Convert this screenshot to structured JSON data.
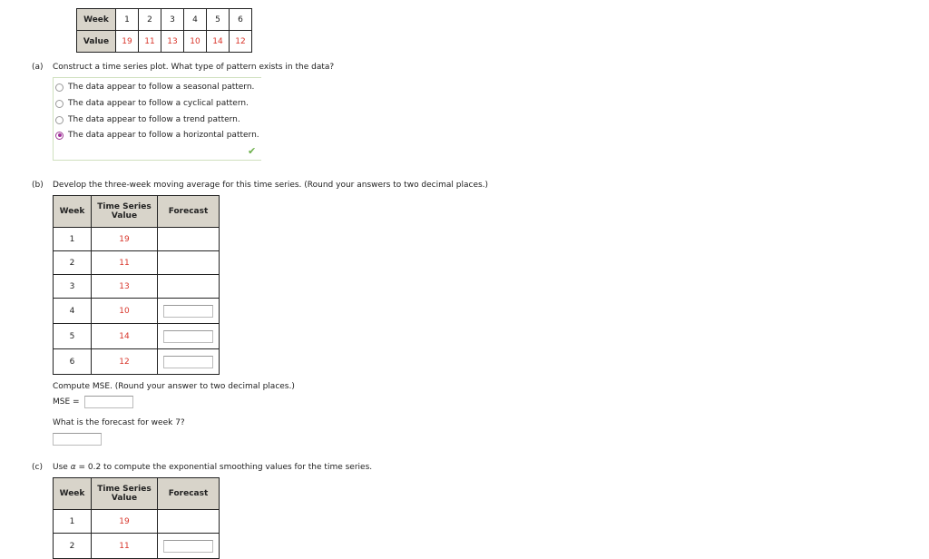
{
  "data_table": {
    "week_label": "Week",
    "value_label": "Value",
    "weeks": [
      "1",
      "2",
      "3",
      "4",
      "5",
      "6"
    ],
    "values": [
      "19",
      "11",
      "13",
      "10",
      "14",
      "12"
    ]
  },
  "part_a": {
    "label": "(a)",
    "question": "Construct a time series plot. What type of pattern exists in the data?",
    "options": [
      {
        "text": "The data appear to follow a seasonal pattern.",
        "selected": false
      },
      {
        "text": "The data appear to follow a cyclical pattern.",
        "selected": false
      },
      {
        "text": "The data appear to follow a trend pattern.",
        "selected": false
      },
      {
        "text": "The data appear to follow a horizontal pattern.",
        "selected": true
      }
    ],
    "status_icon": "checkmark-icon",
    "status_symbol": "✔"
  },
  "part_b": {
    "label": "(b)",
    "question": "Develop the three-week moving average for this time series. (Round your answers to two decimal places.)",
    "table": {
      "headers": [
        "Week",
        "Time Series Value",
        "Forecast"
      ],
      "header_value_line1": "Time Series",
      "header_value_line2": "Value",
      "rows": [
        {
          "week": "1",
          "value": "19",
          "forecast": null
        },
        {
          "week": "2",
          "value": "11",
          "forecast": null
        },
        {
          "week": "3",
          "value": "13",
          "forecast": null
        },
        {
          "week": "4",
          "value": "10",
          "forecast": ""
        },
        {
          "week": "5",
          "value": "14",
          "forecast": ""
        },
        {
          "week": "6",
          "value": "12",
          "forecast": ""
        }
      ]
    },
    "mse_prompt": "Compute MSE. (Round your answer to two decimal places.)",
    "mse_label": "MSE =",
    "mse_value": "",
    "week7_prompt": "What is the forecast for week 7?",
    "week7_value": ""
  },
  "part_c": {
    "label": "(c)",
    "question_prefix": "Use ",
    "alpha_symbol": "α",
    "question_suffix": " = 0.2 to compute the exponential smoothing values for the time series.",
    "table": {
      "header_week": "Week",
      "header_value_line1": "Time Series",
      "header_value_line2": "Value",
      "header_forecast": "Forecast",
      "rows": [
        {
          "week": "1",
          "value": "19",
          "forecast": null
        },
        {
          "week": "2",
          "value": "11",
          "forecast": ""
        }
      ]
    }
  },
  "colors": {
    "value_red": "#d8352a",
    "header_bg": "#d8d4ca",
    "radio_selected": "#a0319b",
    "check_green": "#6db04c",
    "answer_border": "#cfe0bf"
  }
}
